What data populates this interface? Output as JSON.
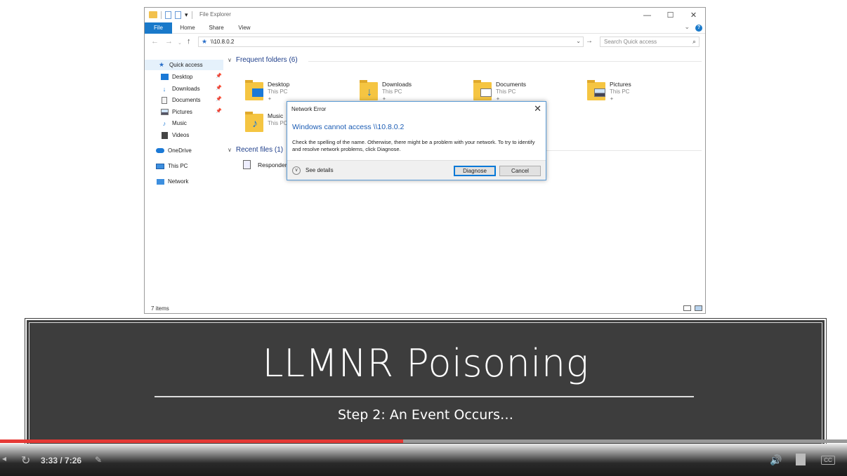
{
  "explorer": {
    "app_title": "File Explorer",
    "ribbon_tabs": [
      "File",
      "Home",
      "Share",
      "View"
    ],
    "address": "\\\\10.8.0.2",
    "search_placeholder": "Search Quick access",
    "nav": {
      "quick_access": "Quick access",
      "items": [
        "Desktop",
        "Downloads",
        "Documents",
        "Pictures",
        "Music",
        "Videos"
      ],
      "onedrive": "OneDrive",
      "this_pc": "This PC",
      "network": "Network"
    },
    "frequent_header": "Frequent folders (6)",
    "folders": [
      {
        "name": "Desktop",
        "location": "This PC"
      },
      {
        "name": "Downloads",
        "location": "This PC"
      },
      {
        "name": "Documents",
        "location": "This PC"
      },
      {
        "name": "Pictures",
        "location": "This PC"
      },
      {
        "name": "Music",
        "location": "This PC"
      }
    ],
    "recent_header": "Recent files (1)",
    "recent_files": [
      "Responder"
    ],
    "status": "7 items"
  },
  "dialog": {
    "title": "Network Error",
    "heading": "Windows cannot access \\\\10.8.0.2",
    "body": "Check the spelling of the name. Otherwise, there might be a problem with your network. To try to identify and resolve network problems, click Diagnose.",
    "see_details": "See details",
    "diagnose": "Diagnose",
    "cancel": "Cancel"
  },
  "slide": {
    "title": "LLMNR Poisoning",
    "subtitle": "Step 2: An Event Occurs…"
  },
  "player": {
    "time": "3:33 / 7:26",
    "progress": 0.476,
    "cc": "CC"
  },
  "colors": {
    "accent": "#1979ca",
    "slide_bg": "#3d3d3d",
    "progress": "#e53935"
  }
}
